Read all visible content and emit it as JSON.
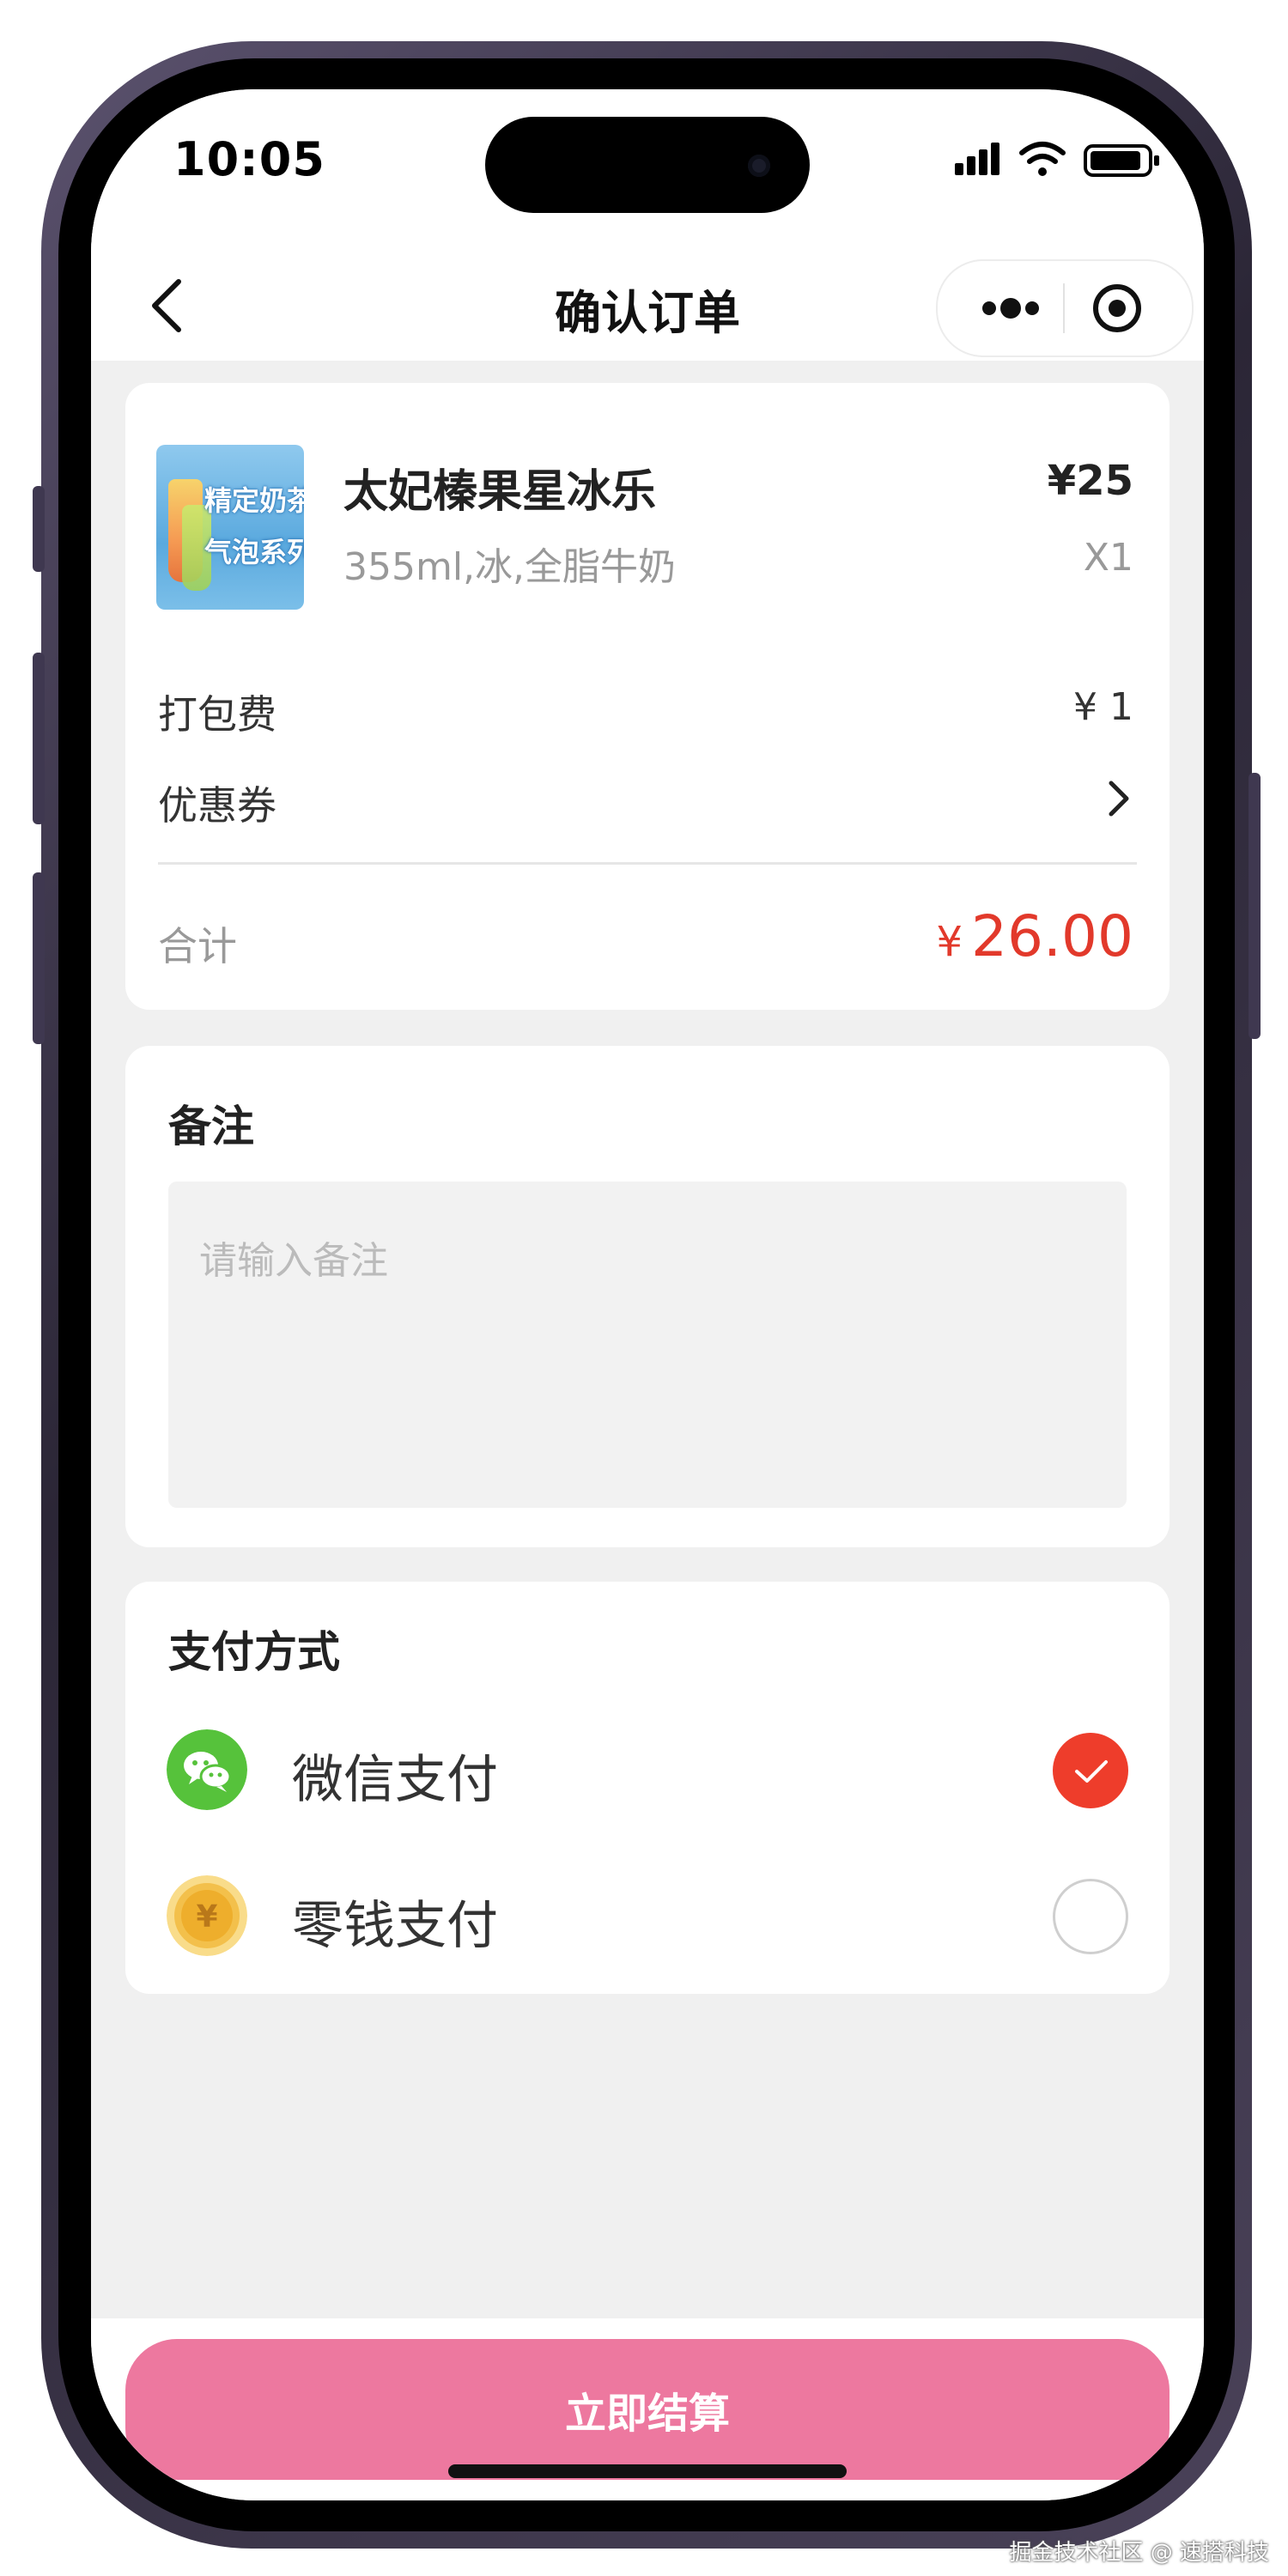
{
  "status_bar": {
    "time": "10:05"
  },
  "nav": {
    "title": "确认订单"
  },
  "order": {
    "product": {
      "image_lines": [
        "精定奶茶",
        "气泡系列"
      ],
      "name": "太妃榛果星冰乐",
      "spec": "355ml,冰,全脂牛奶",
      "price": "¥25",
      "quantity": "X1"
    },
    "packing_fee_label": "打包费",
    "packing_fee_value": "¥ 1",
    "coupon_label": "优惠券",
    "total_label": "合计",
    "total_currency": "¥",
    "total_value": "26.00"
  },
  "remarks": {
    "title": "备注",
    "placeholder": "请输入备注"
  },
  "payment": {
    "title": "支付方式",
    "methods": [
      {
        "label": "微信支付",
        "icon": "wechat-icon",
        "selected": true
      },
      {
        "label": "零钱支付",
        "icon": "coin-icon",
        "selected": false
      }
    ]
  },
  "checkout": {
    "button_label": "立即结算"
  },
  "watermark": "掘金技术社区 @ 速搭科技",
  "colors": {
    "accent_red": "#e2392b",
    "selected_radio": "#ee3d2b",
    "checkout_button": "#ed789f",
    "wechat_green": "#56c23b",
    "coin_gold": "#f3c04b",
    "page_bg": "#f0f0f0"
  }
}
